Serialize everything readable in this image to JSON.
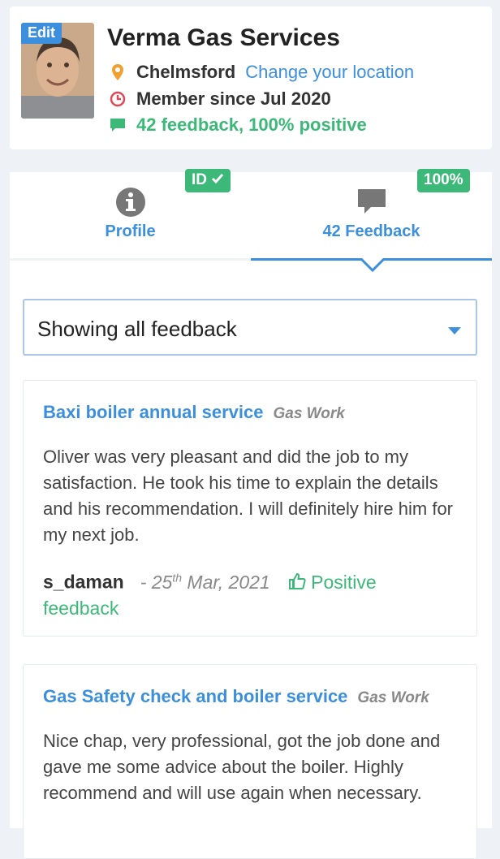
{
  "header": {
    "edit_label": "Edit",
    "business_name": "Verma Gas Services",
    "location": "Chelmsford",
    "change_location": "Change your location",
    "member_since": "Member since Jul 2020",
    "feedback_summary": "42 feedback, 100% positive"
  },
  "tabs": {
    "profile_label": "Profile",
    "profile_badge": "ID",
    "feedback_label": "42 Feedback",
    "feedback_badge": "100%"
  },
  "filter": {
    "selected": "Showing all feedback"
  },
  "feedback": [
    {
      "title": "Baxi boiler annual service",
      "category": "Gas Work",
      "text": "Oliver was very pleasant and did the job to my satisfaction. He took his time to explain the details and his recommendation. I will definitely hire him for my next job.",
      "user": "s_daman",
      "date_prefix": "- 25",
      "date_sup": "th",
      "date_suffix": " Mar, 2021",
      "rating": "Positive",
      "rating_suffix": "feedback"
    },
    {
      "title": "Gas Safety check and boiler service",
      "category": "Gas Work",
      "text": "Nice chap, very professional, got the job done and gave me some advice about the boiler. Highly recommend and will use again when necessary."
    }
  ],
  "colors": {
    "accent": "#3c8fdc",
    "positive": "#3cb878",
    "location_pin": "#f0a030",
    "clock": "#e04858"
  }
}
